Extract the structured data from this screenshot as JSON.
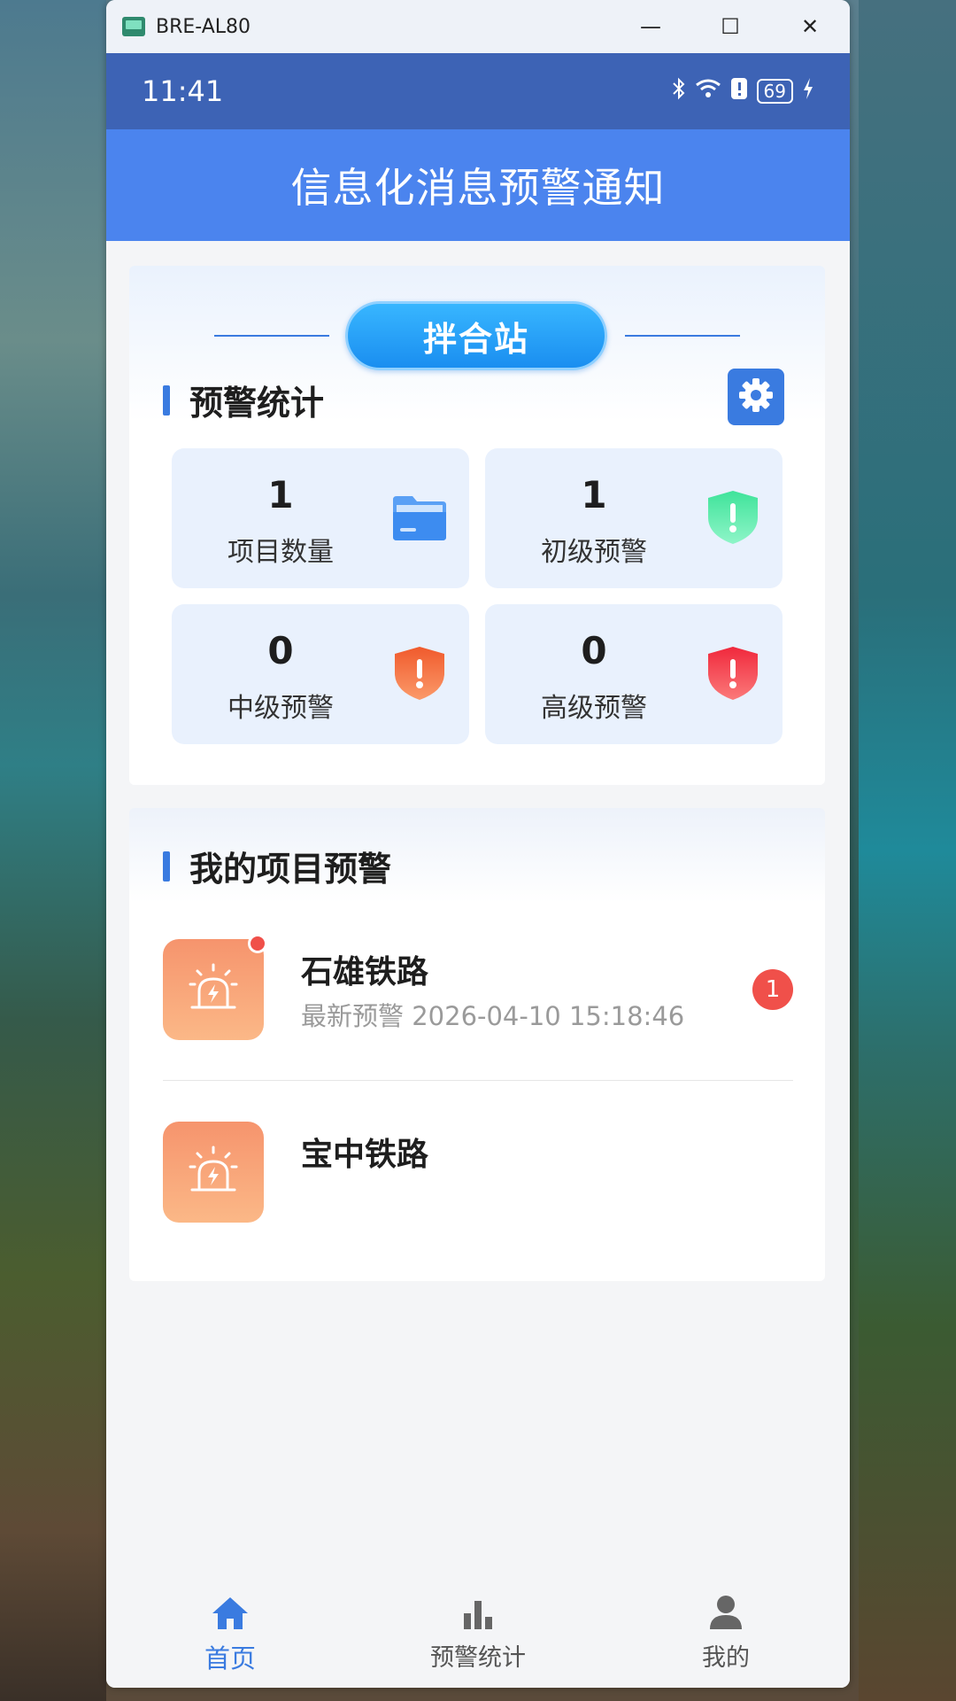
{
  "window": {
    "title": "BRE-AL80",
    "minimize": "—",
    "maximize": "☐",
    "close": "✕"
  },
  "statusbar": {
    "time": "11:41",
    "battery": "69"
  },
  "header": {
    "title": "信息化消息预警通知"
  },
  "station": {
    "label": "拌合站"
  },
  "stats": {
    "section_title": "预警统计",
    "tiles": [
      {
        "value": "1",
        "label": "项目数量",
        "icon": "folder-icon"
      },
      {
        "value": "1",
        "label": "初级预警",
        "icon": "green-shield-icon"
      },
      {
        "value": "0",
        "label": "中级预警",
        "icon": "orange-shield-icon"
      },
      {
        "value": "0",
        "label": "高级预警",
        "icon": "red-shield-icon"
      }
    ]
  },
  "projects": {
    "section_title": "我的项目预警",
    "items": [
      {
        "name": "石雄铁路",
        "subtitle": "最新预警 2026-04-10 15:18:46",
        "badge": "1",
        "has_dot": true
      },
      {
        "name": "宝中铁路",
        "subtitle": "",
        "badge": "",
        "has_dot": false
      }
    ]
  },
  "tabbar": {
    "tabs": [
      {
        "label": "首页",
        "icon": "home-icon",
        "active": true
      },
      {
        "label": "预警统计",
        "icon": "bar-chart-icon",
        "active": false
      },
      {
        "label": "我的",
        "icon": "user-icon",
        "active": false
      }
    ]
  },
  "colors": {
    "primary": "#3a7be0",
    "header": "#4b84ee",
    "statusbar": "#3d63b5",
    "alert": "#f0504a"
  }
}
